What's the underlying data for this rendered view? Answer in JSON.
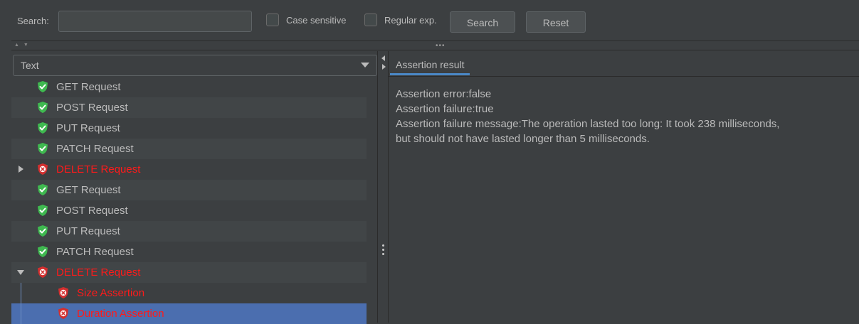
{
  "search": {
    "label": "Search:",
    "value": "",
    "placeholder": "",
    "case_sensitive_label": "Case sensitive",
    "regex_label": "Regular exp.",
    "search_button": "Search",
    "reset_button": "Reset"
  },
  "toolbar": {
    "collapse_arrows": "▲ ▼",
    "dots": "•••"
  },
  "renderer_select": {
    "value": "Text"
  },
  "tree": {
    "rows": [
      {
        "label": "GET Request",
        "status": "ok"
      },
      {
        "label": "POST Request",
        "status": "ok"
      },
      {
        "label": "PUT Request",
        "status": "ok"
      },
      {
        "label": "PATCH Request",
        "status": "ok"
      },
      {
        "label": "DELETE Request",
        "status": "error",
        "expander": "collapsed"
      },
      {
        "label": "GET Request",
        "status": "ok"
      },
      {
        "label": "POST Request",
        "status": "ok"
      },
      {
        "label": "PUT Request",
        "status": "ok"
      },
      {
        "label": "PATCH Request",
        "status": "ok"
      },
      {
        "label": "DELETE Request",
        "status": "error",
        "expander": "expanded"
      },
      {
        "label": "Size Assertion",
        "status": "error",
        "child": true
      },
      {
        "label": "Duration Assertion",
        "status": "error",
        "child": true,
        "selected": true
      }
    ]
  },
  "right": {
    "tab_label": "Assertion result",
    "lines": [
      "Assertion error:false",
      "Assertion failure:true",
      "Assertion failure message:The operation lasted too long: It took 238 milliseconds,\nbut should not have lasted longer than 5 milliseconds."
    ]
  },
  "colors": {
    "background": "#3c3f41",
    "selection": "#4b6eaf",
    "error_text": "#ff1a1a",
    "ok_icon": "#3fb950",
    "error_icon": "#d32f2f"
  }
}
